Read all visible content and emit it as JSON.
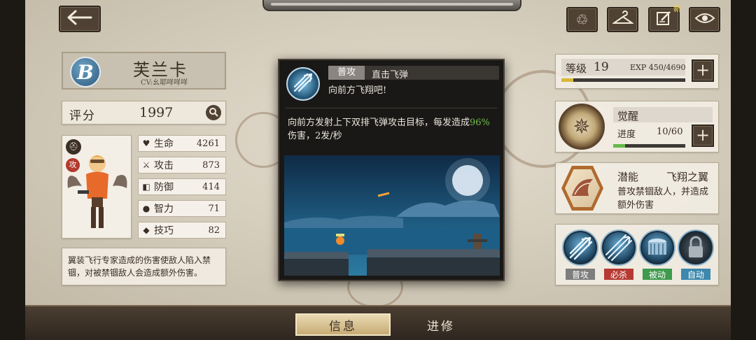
{
  "top_icons": [
    "back-arrow-icon",
    "recycle-icon",
    "hanger-icon",
    "edit-note-icon",
    "eye-icon"
  ],
  "edit_badge": "新",
  "character": {
    "badge_letter": "B",
    "name": "芙兰卡",
    "cv": "CV:幺耶咩咩咩",
    "class_badge": "攻"
  },
  "score": {
    "label": "评分",
    "value": "1997"
  },
  "stats": [
    {
      "label": "生命",
      "value": "4261",
      "icon": "heart-icon"
    },
    {
      "label": "攻击",
      "value": "873",
      "icon": "sword-icon"
    },
    {
      "label": "防御",
      "value": "414",
      "icon": "shield-icon"
    },
    {
      "label": "智力",
      "value": "71",
      "icon": "brain-icon"
    },
    {
      "label": "技巧",
      "value": "82",
      "icon": "book-icon"
    }
  ],
  "description": "翼装飞行专家造成的伤害使敌人陷入禁锢，对被禁锢敌人会造成额外伤害。",
  "level": {
    "label": "等级",
    "value": "19",
    "exp": "EXP 450/4690",
    "exp_progress": 0.096
  },
  "awaken": {
    "label": "觉醒",
    "progress_label": "进度",
    "progress": "10/60",
    "progress_fraction": 0.167
  },
  "potential": {
    "label": "潜能",
    "name": "飞翔之翼",
    "desc": "普攻禁锢敌人，并造成额外伤害"
  },
  "skills": [
    {
      "tag": "普攻",
      "color": "#7e7e7e",
      "icon": "arrow-burst-icon"
    },
    {
      "tag": "必杀",
      "color": "#b63a33",
      "icon": "spread-arrows-icon"
    },
    {
      "tag": "被动",
      "color": "#3e9a4c",
      "icon": "cylinder-icon"
    },
    {
      "tag": "自动",
      "color": "#3d88ad",
      "icon": "lock-icon"
    }
  ],
  "popup": {
    "type": "普攻",
    "skill_name": "直击飞弹",
    "tagline": "向前方飞翔吧!",
    "desc_before": "向前方发射上下双排飞弹攻击目标，每发造成",
    "desc_highlight": "96%",
    "desc_after": "伤害，2发/秒",
    "highlight_color": "#6fc04a"
  },
  "tabs": [
    {
      "label": "信息",
      "active": true
    },
    {
      "label": "进修",
      "active": false
    }
  ]
}
